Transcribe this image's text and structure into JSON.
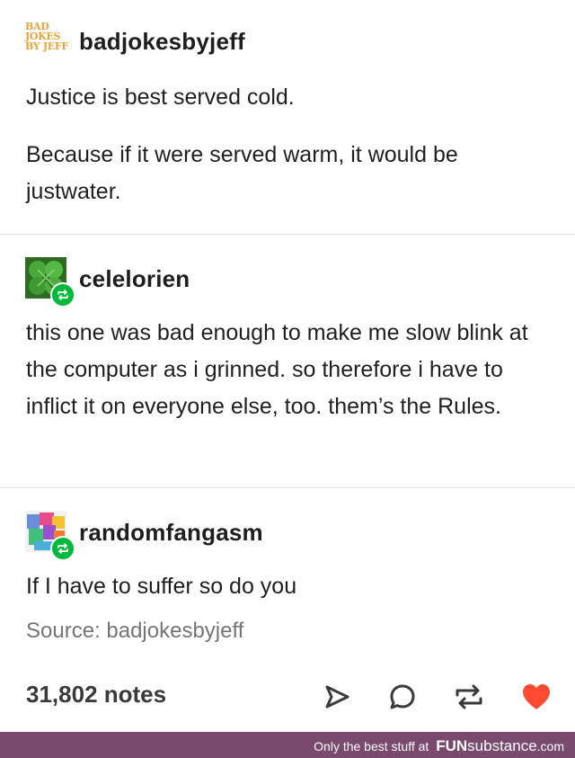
{
  "posts": [
    {
      "username": "badjokesbyjeff",
      "avatar_lines": [
        "BAD",
        "JOKES",
        "BY JEFF"
      ],
      "paragraphs": [
        "Justice is best served cold.",
        "Because if it were served warm, it would be justwater."
      ]
    },
    {
      "username": "celelorien",
      "avatar_icon": "four-leaf-clover",
      "reblog_icon": "reblog-icon",
      "text": "this one was bad enough to make me slow blink at the computer as i grinned. so therefore i have to inflict it on everyone else, too. them’s the Rules."
    },
    {
      "username": "randomfangasm",
      "avatar_icon": "colorful-collage",
      "reblog_icon": "reblog-icon",
      "text": "If I have to suffer so do you"
    }
  ],
  "source": "Source: badjokesbyjeff",
  "notes": "31,802 notes",
  "actions": [
    {
      "icon": "share-icon"
    },
    {
      "icon": "reply-icon"
    },
    {
      "icon": "reblog-icon"
    },
    {
      "icon": "heart-icon",
      "color": "#ff4930"
    }
  ],
  "footer": {
    "tagline": "Only the best stuff at",
    "brand_bold": "FUN",
    "brand_rest": "substance",
    "brand_suffix": ".com"
  },
  "colors": {
    "reblog_green": "#00b83a",
    "footer_bg": "#7a4a6e",
    "logo_orange": "#e8a33a",
    "heart_red": "#ff4930"
  }
}
